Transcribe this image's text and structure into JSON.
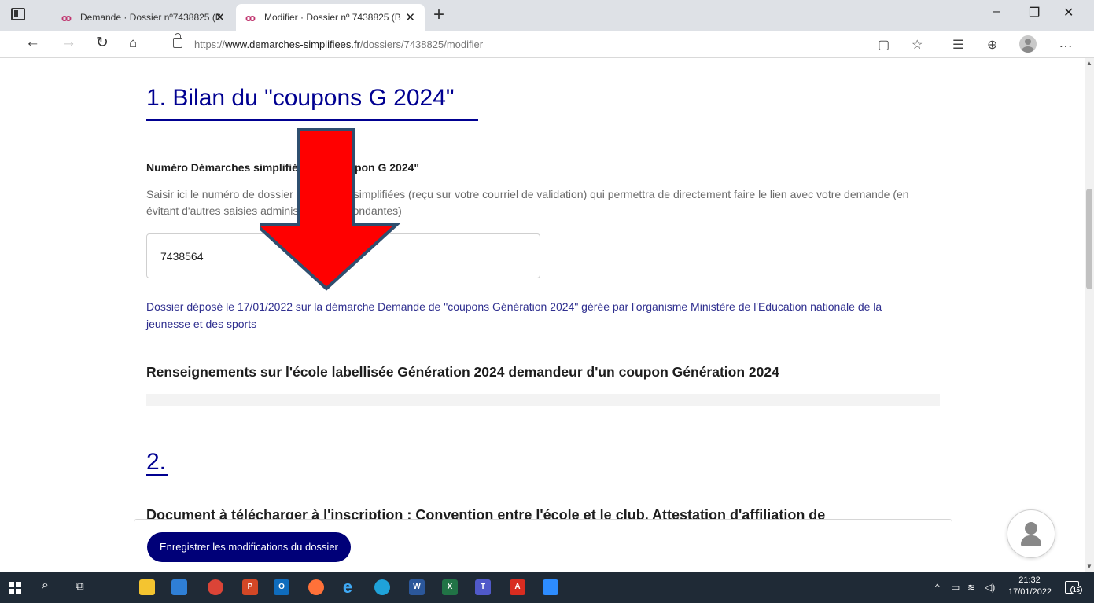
{
  "browser": {
    "tabs": [
      {
        "title": "Demande · Dossier nº7438825 (B",
        "active": false
      },
      {
        "title": "Modifier · Dossier nº 7438825 (B",
        "active": true
      }
    ],
    "url_scheme": "https://",
    "url_host": "www.demarches-simplifiees.fr",
    "url_path": "/dossiers/7438825/modifier"
  },
  "page": {
    "section1_title": "1. Bilan du \"coupons G 2024\"",
    "field_label": "Numéro Démarches simplifiées du \"coupon G 2024\"",
    "field_hint": "Saisir ici le numéro de dossier démarches simplifiées (reçu sur votre courriel de validation) qui permettra de directement faire le lien avec votre demande (en évitant d'autres saisies administratives redondantes)",
    "field_value": "7438564",
    "dossier_info": "Dossier déposé le 17/01/2022 sur la démarche Demande de \"coupons Génération 2024\" gérée par l'organisme Ministère de l'Education nationale de la jeunesse et des sports",
    "subsection_title": "Renseignements sur l'école labellisée Génération 2024 demandeur d'un coupon Génération 2024",
    "section2_title": "2.",
    "truncated_line": "Document à télécharger à l'inscription : Convention entre l'école et le club, Attestation d'affiliation de",
    "save_button": "Enregistrer les modifications du dossier"
  },
  "annotation": {
    "arrow_color": "#ff0000",
    "arrow_outline": "#2f4f6f"
  },
  "taskbar": {
    "apps": [
      "file-explorer",
      "remote-desktop",
      "chrome",
      "powerpoint",
      "outlook",
      "firefox",
      "internet-explorer",
      "edge",
      "word",
      "excel",
      "teams",
      "acrobat",
      "zoom"
    ],
    "time": "21:32",
    "date": "17/01/2022",
    "notification_count": "15"
  },
  "colors": {
    "brand_blue": "#000091",
    "button_blue": "#000078",
    "taskbar": "#1f2a36"
  }
}
